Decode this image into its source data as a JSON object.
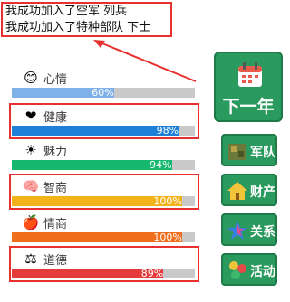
{
  "messages": [
    "我成功加入了空军 列兵",
    "我成功加入了特种部队 下士"
  ],
  "stats": [
    {
      "label": "心情",
      "icon": "smiley-icon",
      "glyph": "😊",
      "percent": 60,
      "percent_text": "60%",
      "color": "#7fb0e8",
      "highlighted": false
    },
    {
      "label": "健康",
      "icon": "heart-icon",
      "glyph": "❤",
      "percent": 98,
      "percent_text": "98%",
      "color": "#1e7fd8",
      "highlighted": true
    },
    {
      "label": "魅力",
      "icon": "sun-icon",
      "glyph": "☀",
      "percent": 94,
      "percent_text": "94%",
      "color": "#16b86f",
      "highlighted": false
    },
    {
      "label": "智商",
      "icon": "brain-icon",
      "glyph": "🧠",
      "percent": 100,
      "percent_text": "100%",
      "color": "#f2b21a",
      "highlighted": true
    },
    {
      "label": "情商",
      "icon": "apple-icon",
      "glyph": "🍎",
      "percent": 100,
      "percent_text": "100%",
      "color": "#f06f1c",
      "highlighted": false
    },
    {
      "label": "道德",
      "icon": "scales-icon",
      "glyph": "⚖",
      "percent": 89,
      "percent_text": "89%",
      "color": "#e43a3a",
      "highlighted": true
    }
  ],
  "next_year": {
    "label": "下一年",
    "icon": "calendar-icon"
  },
  "side_buttons": [
    {
      "label": "军队",
      "icon": "army-icon"
    },
    {
      "label": "财产",
      "icon": "house-icon"
    },
    {
      "label": "关系",
      "icon": "star-icon"
    },
    {
      "label": "活动",
      "icon": "activity-icon"
    }
  ],
  "colors": {
    "highlight": "#e8302e",
    "button_green": "#2a9a5e",
    "track": "#c9c9c9"
  }
}
